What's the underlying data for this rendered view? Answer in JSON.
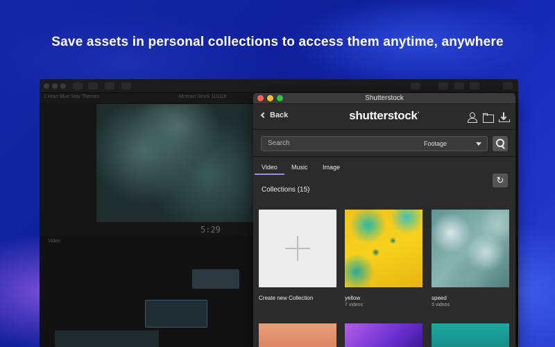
{
  "headline": "Save assets in personal collections to access them anytime, anywhere",
  "background_app": {
    "project_name": "1 Hour Blue Stay Themes",
    "clip_name": "Abstract Stock 110118",
    "timecode": "5:29",
    "timeline_tab": "Video"
  },
  "window": {
    "title": "Shutterstock",
    "back_label": "Back",
    "logo": "shutterstock",
    "logo_mark": "·"
  },
  "search": {
    "placeholder": "Search",
    "media_type": "Footage"
  },
  "tabs": [
    {
      "label": "Video",
      "active": true
    },
    {
      "label": "Music",
      "active": false
    },
    {
      "label": "Image",
      "active": false
    }
  ],
  "collections": {
    "title": "Collections (15)",
    "items": [
      {
        "title": "Create new Collection",
        "subtitle": ""
      },
      {
        "title": "yellow",
        "subtitle": "7 videos"
      },
      {
        "title": "speed",
        "subtitle": "3 videos"
      }
    ]
  },
  "colors": {
    "accent_underline": "#9b8ee8",
    "window_bg": "#2b2b2b",
    "page_bg": "#1427a8"
  }
}
